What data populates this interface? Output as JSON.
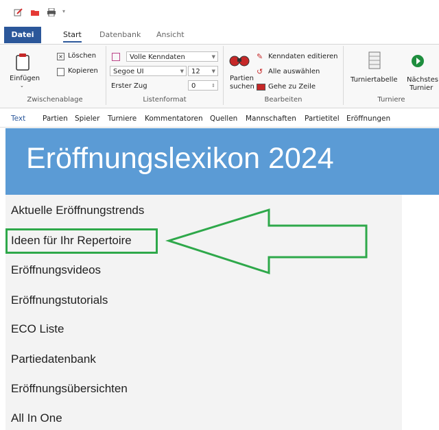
{
  "ribbon_tabs": [
    "Datei",
    "Start",
    "Datenbank",
    "Ansicht"
  ],
  "clipboard": {
    "paste_label": "Einfügen",
    "delete_label": "Löschen",
    "copy_label": "Kopieren",
    "group_title": "Zwischenablage"
  },
  "listformat": {
    "view_value": "Volle Kenndaten",
    "font_value": "Segoe UI",
    "size_value": "12",
    "first_move_label": "Erster Zug",
    "first_move_value": "0",
    "group_title": "Listenformat"
  },
  "edit": {
    "search_label_1": "Partien",
    "search_label_2": "suchen",
    "edit_data_label": "Kenndaten editieren",
    "select_all_label": "Alle auswählen",
    "goto_row_label": "Gehe zu Zeile",
    "group_title": "Bearbeiten"
  },
  "tournaments": {
    "table_label": "Turniertabelle",
    "next_label_1": "Nächstes",
    "next_label_2": "Turnier",
    "group_title": "Turniere"
  },
  "nav_tabs": [
    "Text",
    "Partien",
    "Spieler",
    "Turniere",
    "Kommentatoren",
    "Quellen",
    "Mannschaften",
    "Partietitel",
    "Eröffnungen"
  ],
  "banner_title": "Eröffnungslexikon 2024",
  "menu_items": [
    "Aktuelle Eröffnungstrends",
    "Ideen für Ihr Repertoire",
    "Eröffnungsvideos",
    "Eröffnungstutorials",
    "ECO Liste",
    "Partiedatenbank",
    "Eröffnungsübersichten",
    "All In One"
  ],
  "colors": {
    "file_tab": "#2b579a",
    "banner": "#5b9bd5",
    "highlight": "#2ea84a"
  }
}
